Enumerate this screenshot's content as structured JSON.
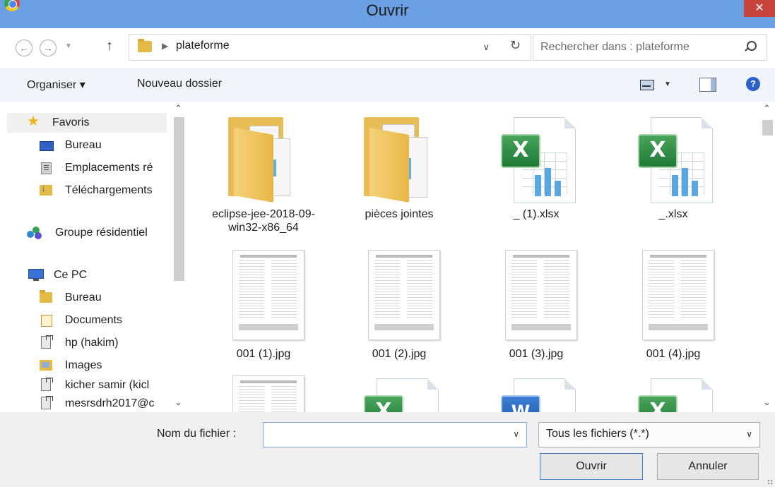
{
  "window": {
    "title": "Ouvrir",
    "close_label": "✕"
  },
  "address": {
    "back_icon": "←",
    "forward_icon": "→",
    "up_icon": "↑",
    "path_item": "plateforme",
    "search_placeholder": "Rechercher dans : plateforme"
  },
  "toolbar": {
    "organize": "Organiser ▾",
    "new_folder": "Nouveau dossier",
    "help": "?"
  },
  "sidebar": {
    "favorites": "Favoris",
    "bureau": "Bureau",
    "emplacements": "Emplacements ré",
    "telechargements": "Téléchargements",
    "groupe": "Groupe résidentiel",
    "cepc": "Ce PC",
    "bureau2": "Bureau",
    "documents": "Documents",
    "hp": "hp (hakim)",
    "images": "Images",
    "kicher": "kicher samir (kicl",
    "mesrs": "mesrsdrh2017@c"
  },
  "files": [
    {
      "name": "eclipse-jee-2018-09-win32-x86_64",
      "kind": "folder"
    },
    {
      "name": "pièces jointes",
      "kind": "folder"
    },
    {
      "name": "_ (1).xlsx",
      "kind": "excel"
    },
    {
      "name": "_.xlsx",
      "kind": "excel"
    },
    {
      "name": "001 (1).jpg",
      "kind": "jpg"
    },
    {
      "name": "001 (2).jpg",
      "kind": "jpg"
    },
    {
      "name": "001 (3).jpg",
      "kind": "jpg"
    },
    {
      "name": "001 (4).jpg",
      "kind": "jpg"
    }
  ],
  "bottom": {
    "filename_label": "Nom du fichier :",
    "filename_value": "",
    "filetype_value": "Tous les fichiers (*.*)",
    "open_button": "Ouvrir",
    "cancel_button": "Annuler"
  },
  "colors": {
    "titlebar": "#6a9fe3",
    "close_button": "#c7443c",
    "toolbar_bg": "#f1f5fb",
    "folder": "#e5b945",
    "excel_green": "#1e7a36",
    "word_blue": "#1b55a8"
  }
}
